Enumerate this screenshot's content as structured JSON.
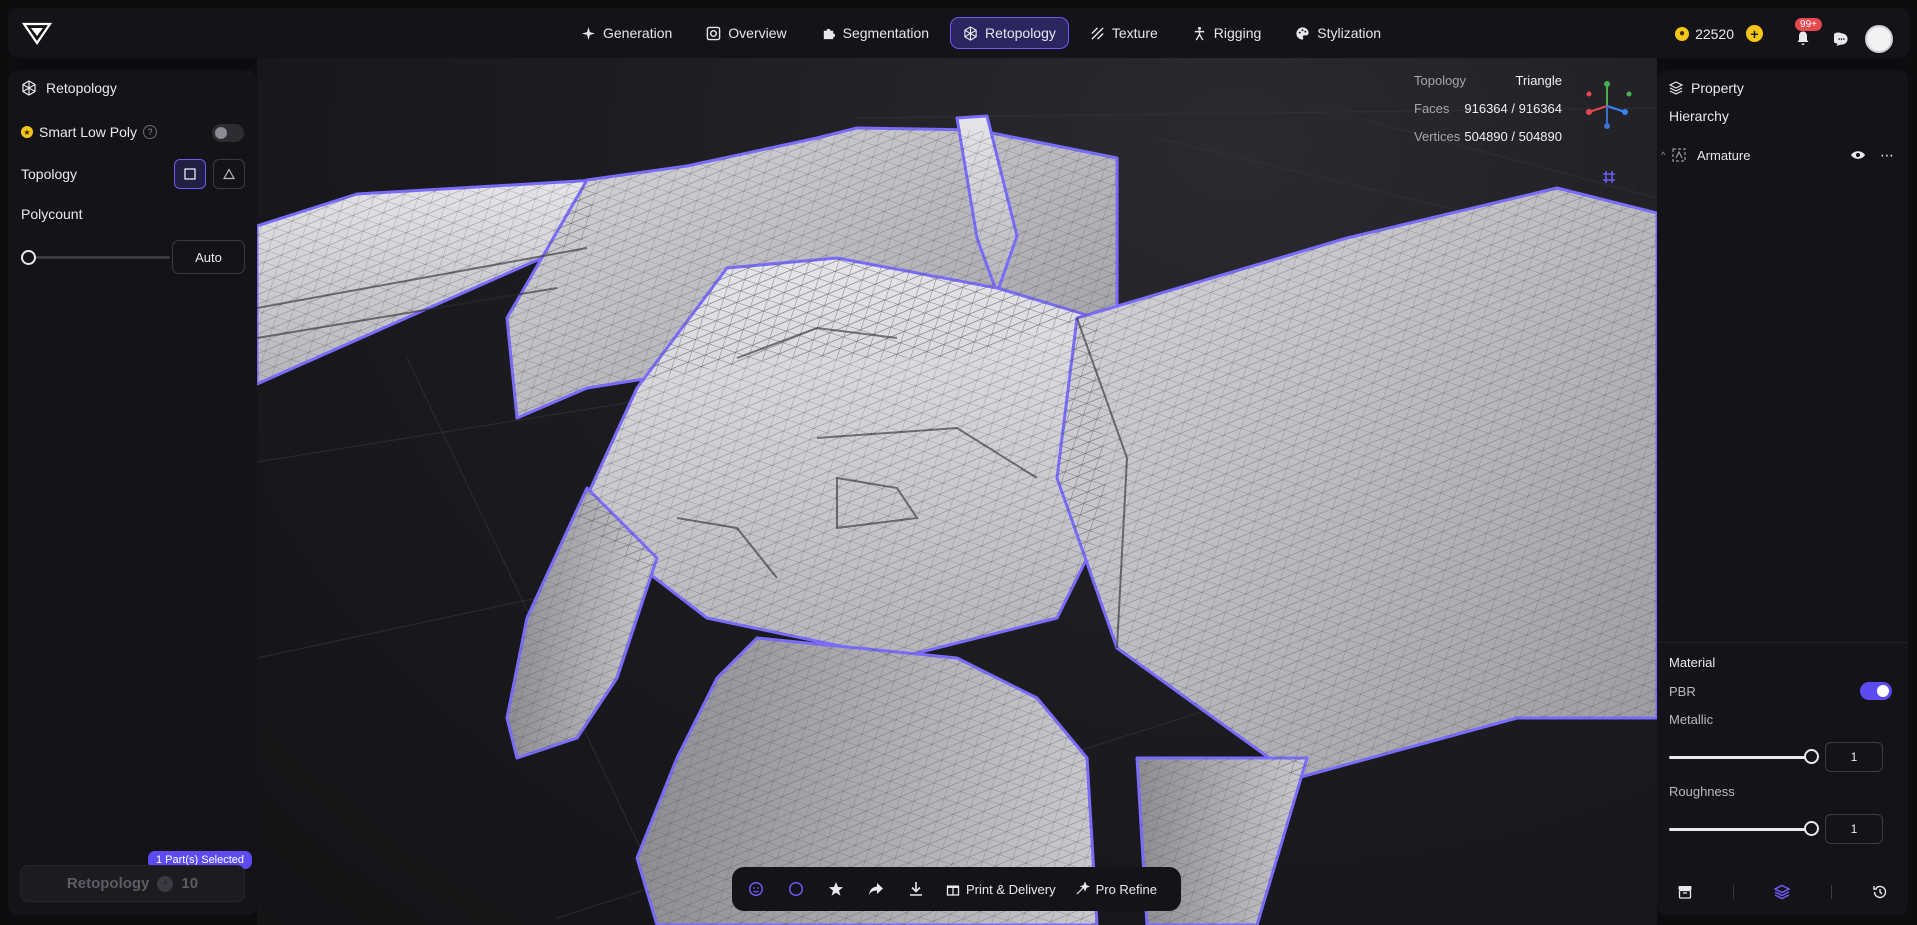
{
  "nav": {
    "items": [
      {
        "label": "Generation",
        "icon": "sparkle-icon"
      },
      {
        "label": "Overview",
        "icon": "overview-icon"
      },
      {
        "label": "Segmentation",
        "icon": "puzzle-icon"
      },
      {
        "label": "Retopology",
        "icon": "retopology-icon",
        "active": true
      },
      {
        "label": "Texture",
        "icon": "texture-icon"
      },
      {
        "label": "Rigging",
        "icon": "rigging-icon"
      },
      {
        "label": "Stylization",
        "icon": "palette-icon"
      }
    ]
  },
  "header": {
    "credits": "22520",
    "notifications": "99+"
  },
  "left_panel": {
    "title": "Retopology",
    "smart_low_poly": "Smart Low Poly",
    "topology_label": "Topology",
    "polycount_label": "Polycount",
    "polycount_value": "Auto",
    "parts_selected": "1 Part(s) Selected",
    "action_button": "Retopology",
    "cost": "10"
  },
  "stats": {
    "topology_label": "Topology",
    "topology_value": "Triangle",
    "faces_label": "Faces",
    "faces_value": "916364 / 916364",
    "vertices_label": "Vertices",
    "vertices_value": "504890 / 504890"
  },
  "right_panel": {
    "property_title": "Property",
    "hierarchy_label": "Hierarchy",
    "tree_item": "Armature",
    "material_label": "Material",
    "pbr_label": "PBR",
    "metallic_label": "Metallic",
    "metallic_value": "1",
    "roughness_label": "Roughness",
    "roughness_value": "1"
  },
  "bottom_bar": {
    "print_label": "Print & Delivery",
    "refine_label": "Pro Refine"
  },
  "colors": {
    "accent": "#6a5cf2",
    "outline": "#7b6cff",
    "coin": "#f5c518",
    "badge": "#e5484d"
  }
}
